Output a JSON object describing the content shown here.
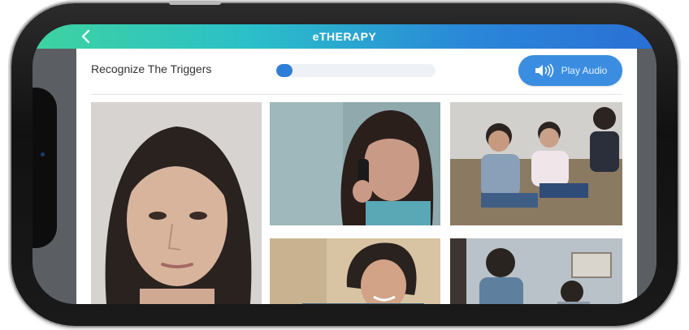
{
  "app": {
    "title": "eTHERAPY"
  },
  "task": {
    "title": "Recognize The Triggers",
    "progress": 0.1
  },
  "audio": {
    "label": "Play Audio",
    "icon": "speaker-icon"
  },
  "header": {
    "back_icon": "chevron-left-icon"
  },
  "photos": [
    {
      "name": "photo-woman-portrait"
    },
    {
      "name": "photo-woman-on-phone"
    },
    {
      "name": "photo-group-on-couch"
    },
    {
      "name": "photo-man-smiling"
    },
    {
      "name": "photo-people-in-room"
    }
  ],
  "colors": {
    "accent": "#3a8de0",
    "header_start": "#3ed3a0",
    "header_end": "#2a6fd6"
  }
}
